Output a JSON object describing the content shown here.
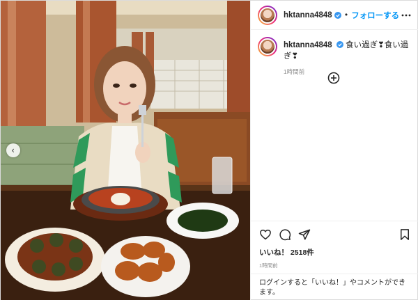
{
  "post": {
    "username": "hktanna4848",
    "follow_label": "フォローする",
    "caption_text": "食い過ぎ❣食い過ぎ❣",
    "caption_time": "1時間前",
    "likes_prefix": "いいね！",
    "likes_count": "2518件",
    "timestamp": "1時間前"
  },
  "login_prompt": {
    "link_label": "ログイン",
    "text": "すると「いいね！」やコメントができます。"
  },
  "icons": {
    "verified": "verified-badge-icon",
    "more": "more-options-icon",
    "add_comment": "add-comment-icon",
    "like": "heart-icon",
    "comment": "comment-icon",
    "share": "share-icon",
    "save": "bookmark-icon",
    "carousel_prev": "chevron-left-icon"
  },
  "colors": {
    "accent": "#0095f6",
    "verified": "#3897f0",
    "secondary_text": "#8e8e8e",
    "border": "#efefef"
  }
}
